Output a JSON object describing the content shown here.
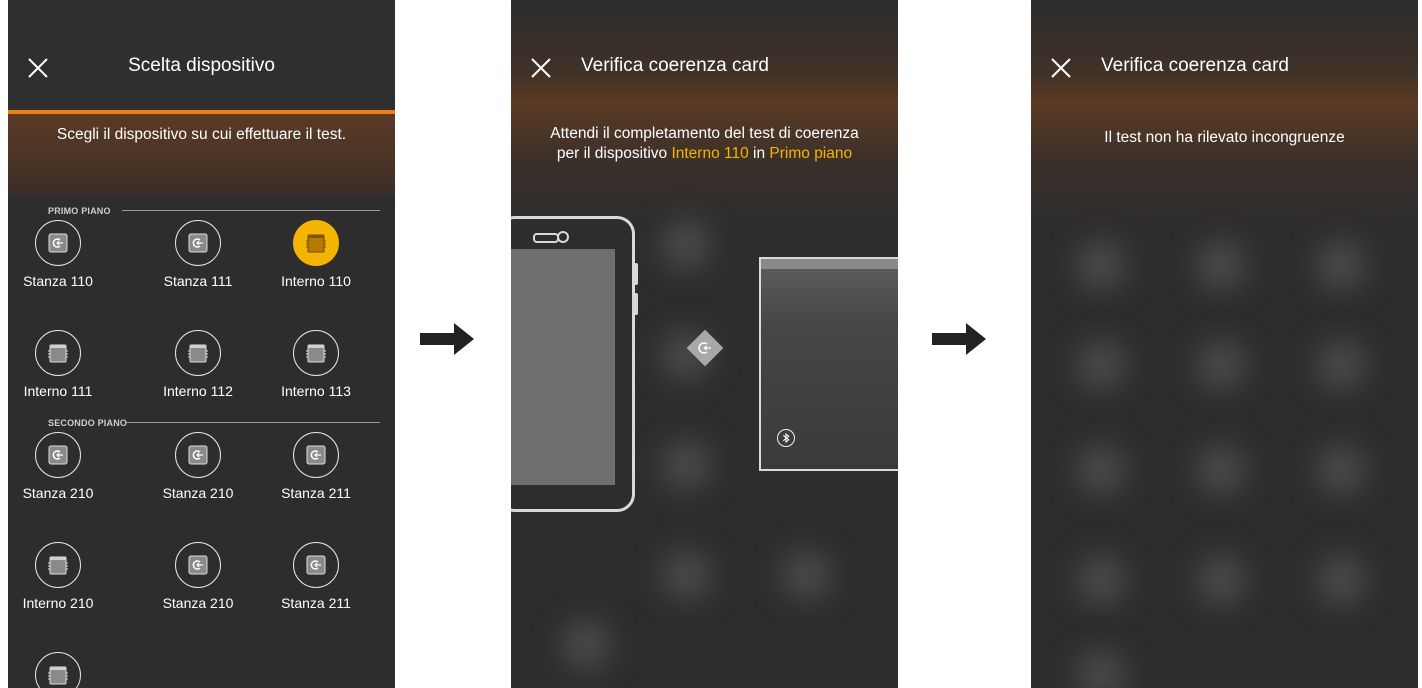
{
  "screen1": {
    "title": "Scelta dispositivo",
    "banner": "Scegli il dispositivo su cui effettuare il test.",
    "sections": [
      {
        "label": "PRIMO PIANO",
        "devices": [
          {
            "label": "Stanza 110",
            "icon": "room-card-icon",
            "selected": false
          },
          {
            "label": "Stanza 111",
            "icon": "room-card-icon",
            "selected": false
          },
          {
            "label": "Interno 110",
            "icon": "device-icon",
            "selected": true
          },
          {
            "label": "Interno 111",
            "icon": "device-icon",
            "selected": false
          },
          {
            "label": "Interno 112",
            "icon": "device-icon",
            "selected": false
          },
          {
            "label": "Interno 113",
            "icon": "device-icon",
            "selected": false
          }
        ]
      },
      {
        "label": "SECONDO PIANO",
        "devices": [
          {
            "label": "Stanza 210",
            "icon": "room-card-icon",
            "selected": false
          },
          {
            "label": "Stanza 210",
            "icon": "room-card-icon",
            "selected": false
          },
          {
            "label": "Stanza 211",
            "icon": "room-card-icon",
            "selected": false
          },
          {
            "label": "Interno 210",
            "icon": "device-icon",
            "selected": false
          },
          {
            "label": "Stanza 210",
            "icon": "room-card-icon",
            "selected": false
          },
          {
            "label": "Stanza 211",
            "icon": "room-card-icon",
            "selected": false
          },
          {
            "label": "",
            "icon": "device-icon",
            "selected": false
          }
        ]
      }
    ]
  },
  "screen2": {
    "title": "Verifica coerenza card",
    "message_line1": "Attendi il completamento del test di coerenza",
    "message_line2_prefix": "per il dispositivo ",
    "device_name": "Interno 110",
    "message_in": " in ",
    "floor_name": "Primo piano"
  },
  "screen3": {
    "title": "Verifica coerenza card",
    "message": "Il test non ha rilevato incongruenze"
  },
  "colors": {
    "accent": "#f07f13",
    "highlight": "#f4b400",
    "background": "#2d2d2d"
  }
}
